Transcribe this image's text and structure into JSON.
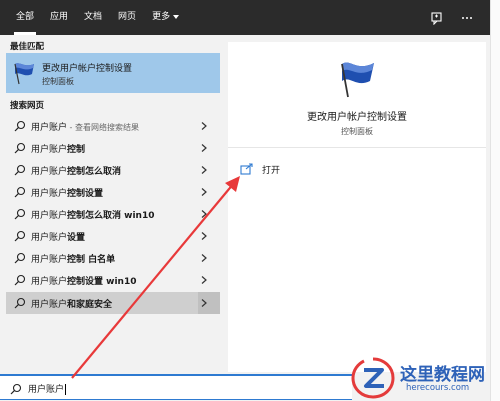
{
  "tabs": [
    {
      "label": "全部"
    },
    {
      "label": "应用"
    },
    {
      "label": "文档"
    },
    {
      "label": "网页"
    },
    {
      "label": "更多"
    }
  ],
  "best_match": {
    "section_title": "最佳匹配",
    "title": "更改用户帐户控制设置",
    "subtitle": "控制面板"
  },
  "web_search": {
    "section_title": "搜索网页",
    "items": [
      {
        "prefix": "用户账户",
        "suffix": " - 查看网络搜索结果",
        "bold": ""
      },
      {
        "prefix": "用户账户",
        "suffix": "",
        "bold": "控制"
      },
      {
        "prefix": "用户账户",
        "suffix": "",
        "bold": "控制怎么取消"
      },
      {
        "prefix": "用户账户",
        "suffix": "",
        "bold": "控制设置"
      },
      {
        "prefix": "用户账户",
        "suffix": "",
        "bold": "控制怎么取消 win10"
      },
      {
        "prefix": "用户账户",
        "suffix": "",
        "bold": "设置"
      },
      {
        "prefix": "用户账户",
        "suffix": "",
        "bold": "控制 白名单"
      },
      {
        "prefix": "用户账户",
        "suffix": "",
        "bold": "控制设置 win10"
      },
      {
        "prefix": "用户账户",
        "suffix": "",
        "bold": "和家庭安全"
      }
    ]
  },
  "detail": {
    "title": "更改用户帐户控制设置",
    "subtitle": "控制面板",
    "open_label": "打开"
  },
  "search": {
    "value": "用户账户"
  },
  "watermark": {
    "name": "这里教程网",
    "url": "herecours.com"
  },
  "colors": {
    "accent": "#2e7ad1",
    "highlight": "#9fc8ea",
    "arrow": "#e8393a",
    "topbar": "#2b2b2b"
  }
}
